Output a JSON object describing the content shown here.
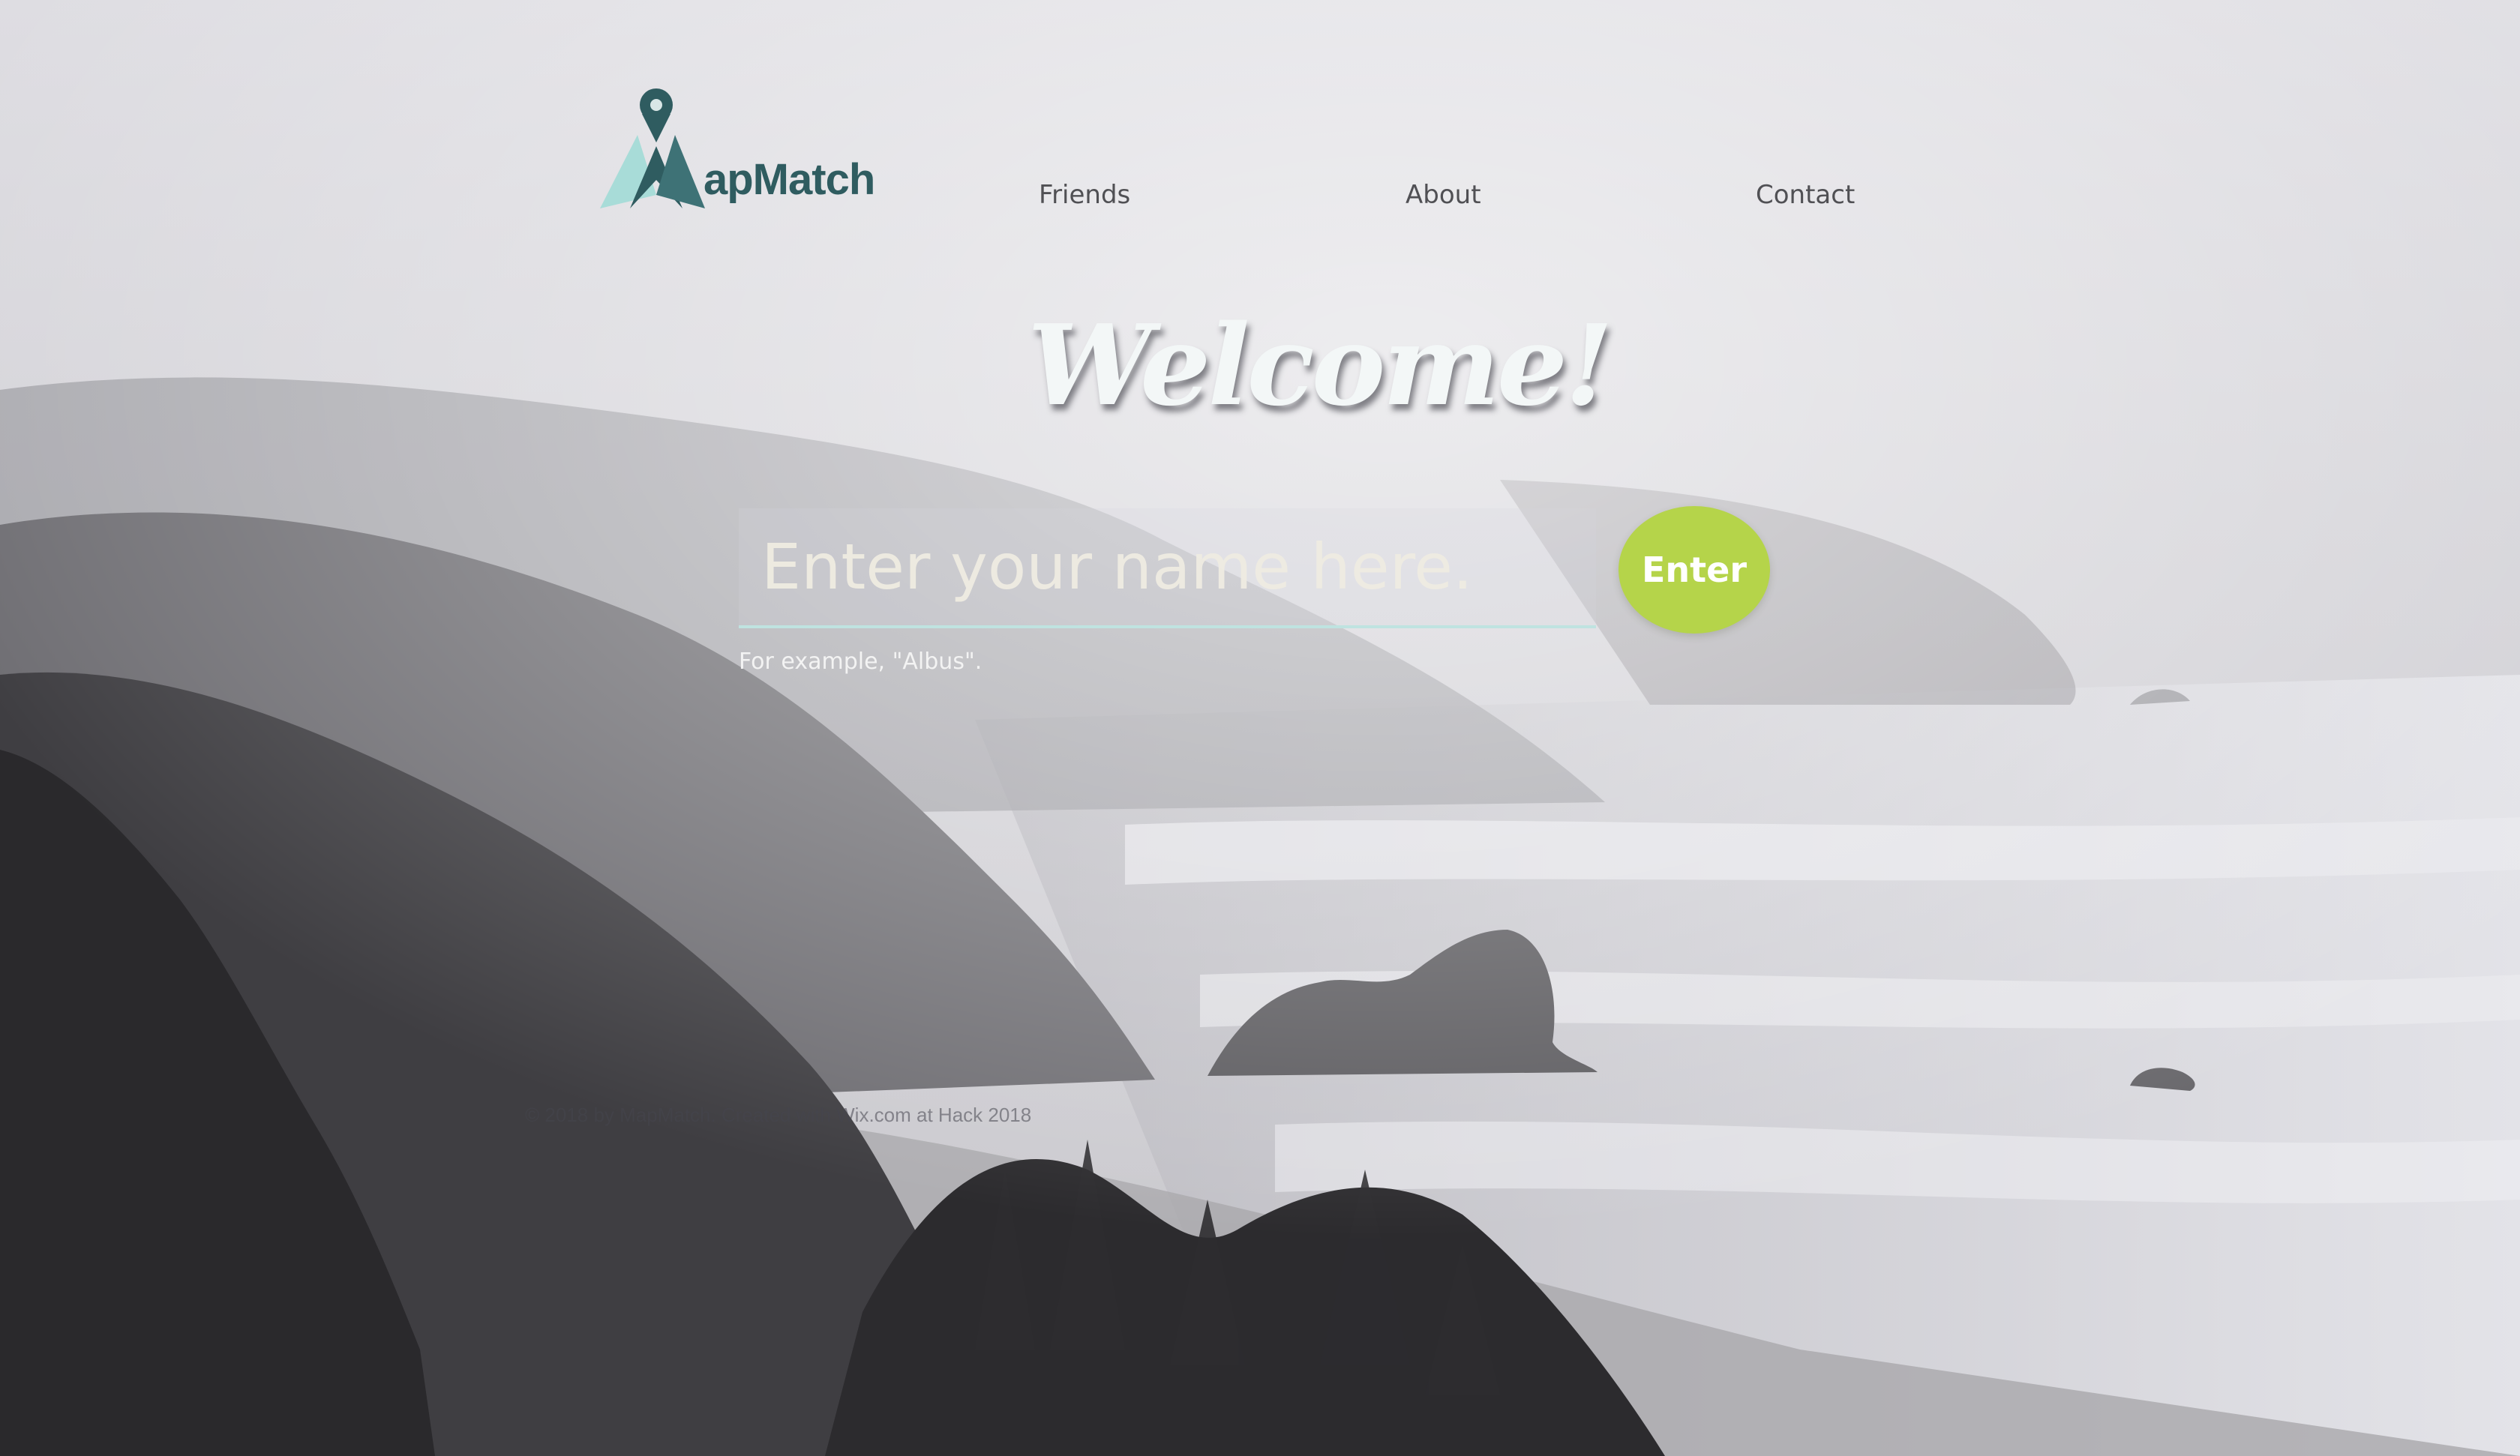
{
  "brand": {
    "logo_text": "apMatch",
    "logo_icon": "map-pin-icon",
    "logo_color": "#2f5c60",
    "logo_accent_color": "#a8dcd8"
  },
  "nav": {
    "items": [
      {
        "label": "Friends"
      },
      {
        "label": "About"
      },
      {
        "label": "Contact"
      }
    ]
  },
  "hero": {
    "title": "Welcome!"
  },
  "form": {
    "name_placeholder": "Enter your name here.",
    "name_value": "",
    "hint": "For example, \"Albus\".",
    "submit_label": "Enter",
    "accent_color": "#b5d44a"
  },
  "footer": {
    "text": "© 2018 by MapMatch. Created with Wix.com at Hack 2018"
  }
}
